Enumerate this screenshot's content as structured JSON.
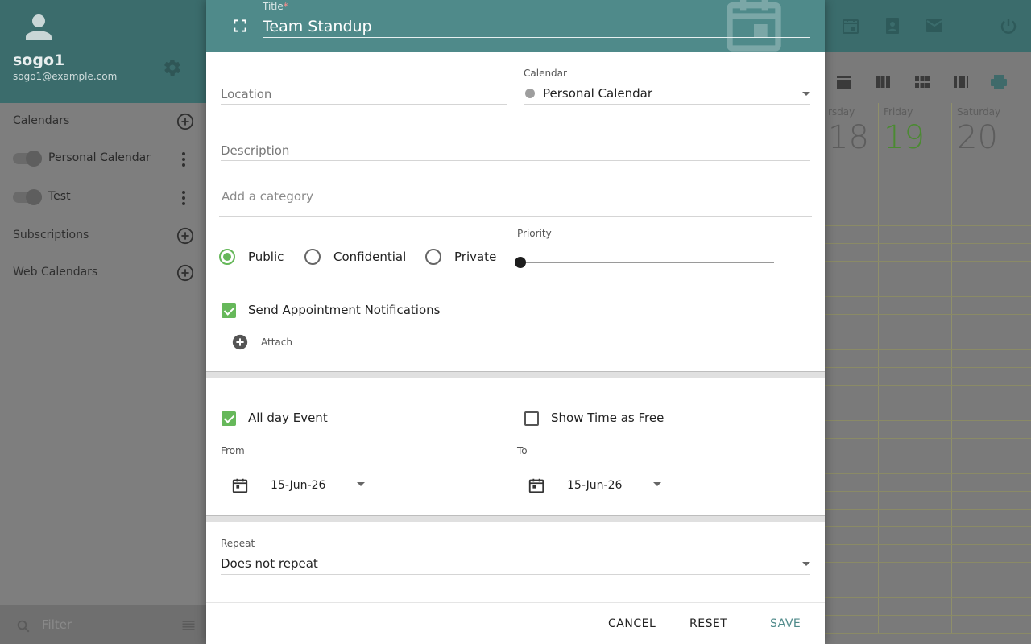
{
  "user": {
    "name": "sogo1",
    "email": "sogo1@example.com"
  },
  "sidebar": {
    "calendars_label": "Calendars",
    "calendars": [
      {
        "label": "Personal Calendar"
      },
      {
        "label": "Test"
      }
    ],
    "subscriptions_label": "Subscriptions",
    "web_calendars_label": "Web Calendars",
    "filter_placeholder": "Filter"
  },
  "week": {
    "days": [
      {
        "name": "rsday",
        "num": "18"
      },
      {
        "name": "Friday",
        "num": "19"
      },
      {
        "name": "Saturday",
        "num": "20"
      }
    ]
  },
  "dialog": {
    "title_label": "Title",
    "title_value": "Team Standup",
    "location_placeholder": "Location",
    "calendar_label": "Calendar",
    "calendar_value": "Personal Calendar",
    "description_placeholder": "Description",
    "category_placeholder": "Add a category",
    "privacy_options": [
      {
        "label": "Public",
        "selected": true
      },
      {
        "label": "Confidential",
        "selected": false
      },
      {
        "label": "Private",
        "selected": false
      }
    ],
    "priority_label": "Priority",
    "priority_value": 0,
    "send_notifications_label": "Send Appointment Notifications",
    "send_notifications_checked": true,
    "attach_label": "Attach",
    "all_day_label": "All day Event",
    "all_day_checked": true,
    "show_free_label": "Show Time as Free",
    "show_free_checked": false,
    "from_label": "From",
    "from_value": "15-Jun-26",
    "to_label": "To",
    "to_value": "15-Jun-26",
    "repeat_label": "Repeat",
    "repeat_value": "Does not repeat",
    "buttons": {
      "cancel": "CANCEL",
      "reset": "RESET",
      "save": "SAVE"
    }
  },
  "colors": {
    "header": "#4f8a8a",
    "accent": "#66b85a",
    "topbar": "#3b6c6c"
  }
}
